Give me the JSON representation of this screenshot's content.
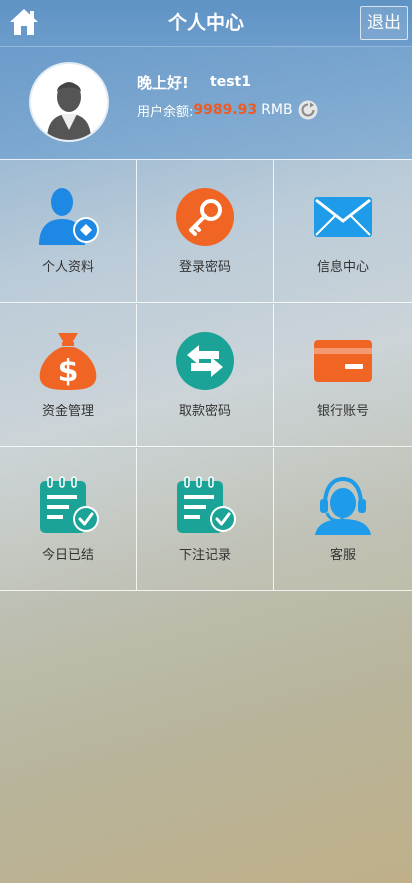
{
  "header": {
    "title": "个人中心",
    "logout_label": "退出"
  },
  "profile": {
    "greeting": "晚上好!",
    "username": "test1",
    "balance_label": "用户余额:",
    "balance_value": "9989.93",
    "currency": "RMB"
  },
  "menu": [
    {
      "label": "个人资料",
      "icon": "user-profile-icon",
      "color": "#1e88e5"
    },
    {
      "label": "登录密码",
      "icon": "key-icon",
      "color": "#f06424"
    },
    {
      "label": "信息中心",
      "icon": "envelope-icon",
      "color": "#1e9be9"
    },
    {
      "label": "资金管理",
      "icon": "money-bag-icon",
      "color": "#f06424"
    },
    {
      "label": "取款密码",
      "icon": "transfer-arrows-icon",
      "color": "#1aa396"
    },
    {
      "label": "银行账号",
      "icon": "bank-card-icon",
      "color": "#f06424"
    },
    {
      "label": "今日已结",
      "icon": "clipboard-check-icon",
      "color": "#1aa396"
    },
    {
      "label": "下注记录",
      "icon": "clipboard-check-icon",
      "color": "#1aa396"
    },
    {
      "label": "客服",
      "icon": "customer-service-icon",
      "color": "#1e9be9"
    }
  ]
}
